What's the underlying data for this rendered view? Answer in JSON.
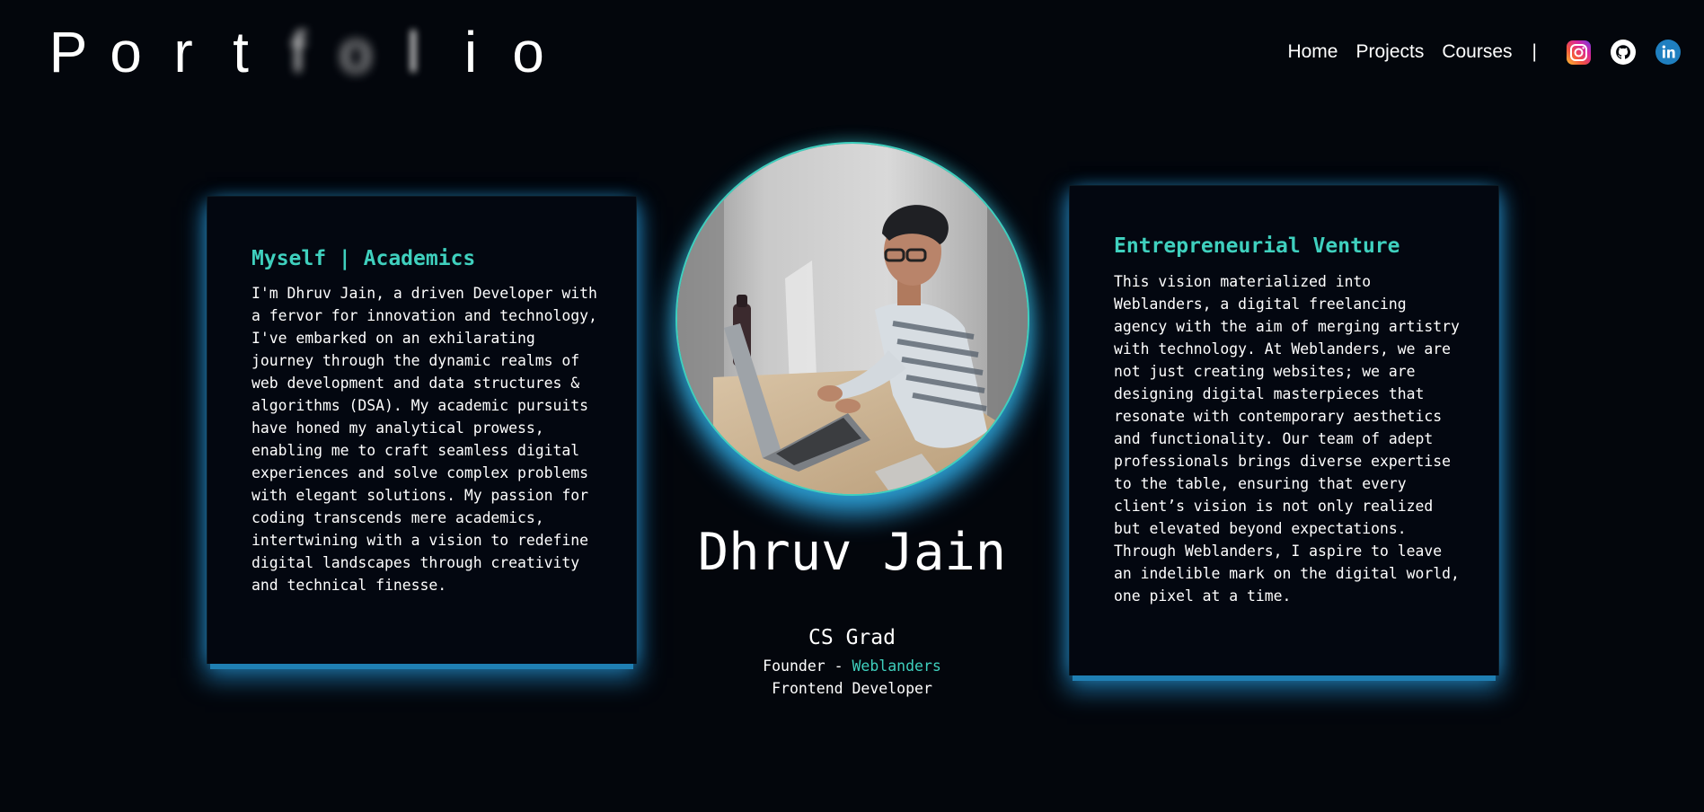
{
  "header": {
    "logo_letters": [
      "P",
      "o",
      "r",
      "t",
      "f",
      "o",
      "l",
      "i",
      "o"
    ],
    "nav": {
      "home": "Home",
      "projects": "Projects",
      "courses": "Courses",
      "separator": "|"
    },
    "social": [
      {
        "name": "instagram-icon"
      },
      {
        "name": "github-icon"
      },
      {
        "name": "linkedin-icon"
      }
    ]
  },
  "left_card": {
    "title": "Myself | Academics",
    "body": "I'm Dhruv Jain, a driven Developer with\na fervor for innovation and technology,\nI've embarked on an exhilarating\njourney through the dynamic realms of\nweb development and data structures &\nalgorithms (DSA). My academic pursuits\nhave honed my analytical prowess,\nenabling me to craft seamless digital\nexperiences and solve complex problems\nwith elegant solutions. My passion for\ncoding transcends mere academics,\nintertwining with a vision to redefine\ndigital landscapes through creativity\nand technical finesse."
  },
  "right_card": {
    "title": "Entrepreneurial Venture",
    "body": "This vision materialized into\nWeblanders, a digital freelancing\nagency with the aim of merging artistry\nwith technology. At Weblanders, we are\nnot just creating websites; we are\ndesigning digital masterpieces that\nresonate with contemporary aesthetics\nand functionality. Our team of adept\nprofessionals brings diverse expertise\nto the table, ensuring that every\nclient’s vision is not only realized\nbut elevated beyond expectations.\nThrough Weblanders, I aspire to leave\nan indelible mark on the digital world,\none pixel at a time."
  },
  "profile": {
    "name": "Dhruv Jain",
    "degree": "CS Grad",
    "founder_prefix": "Founder - ",
    "founder_company": "Weblanders",
    "role": "Frontend Developer"
  },
  "colors": {
    "background": "#03060c",
    "accent": "#3fd0be",
    "glow": "#2fa8e5"
  }
}
